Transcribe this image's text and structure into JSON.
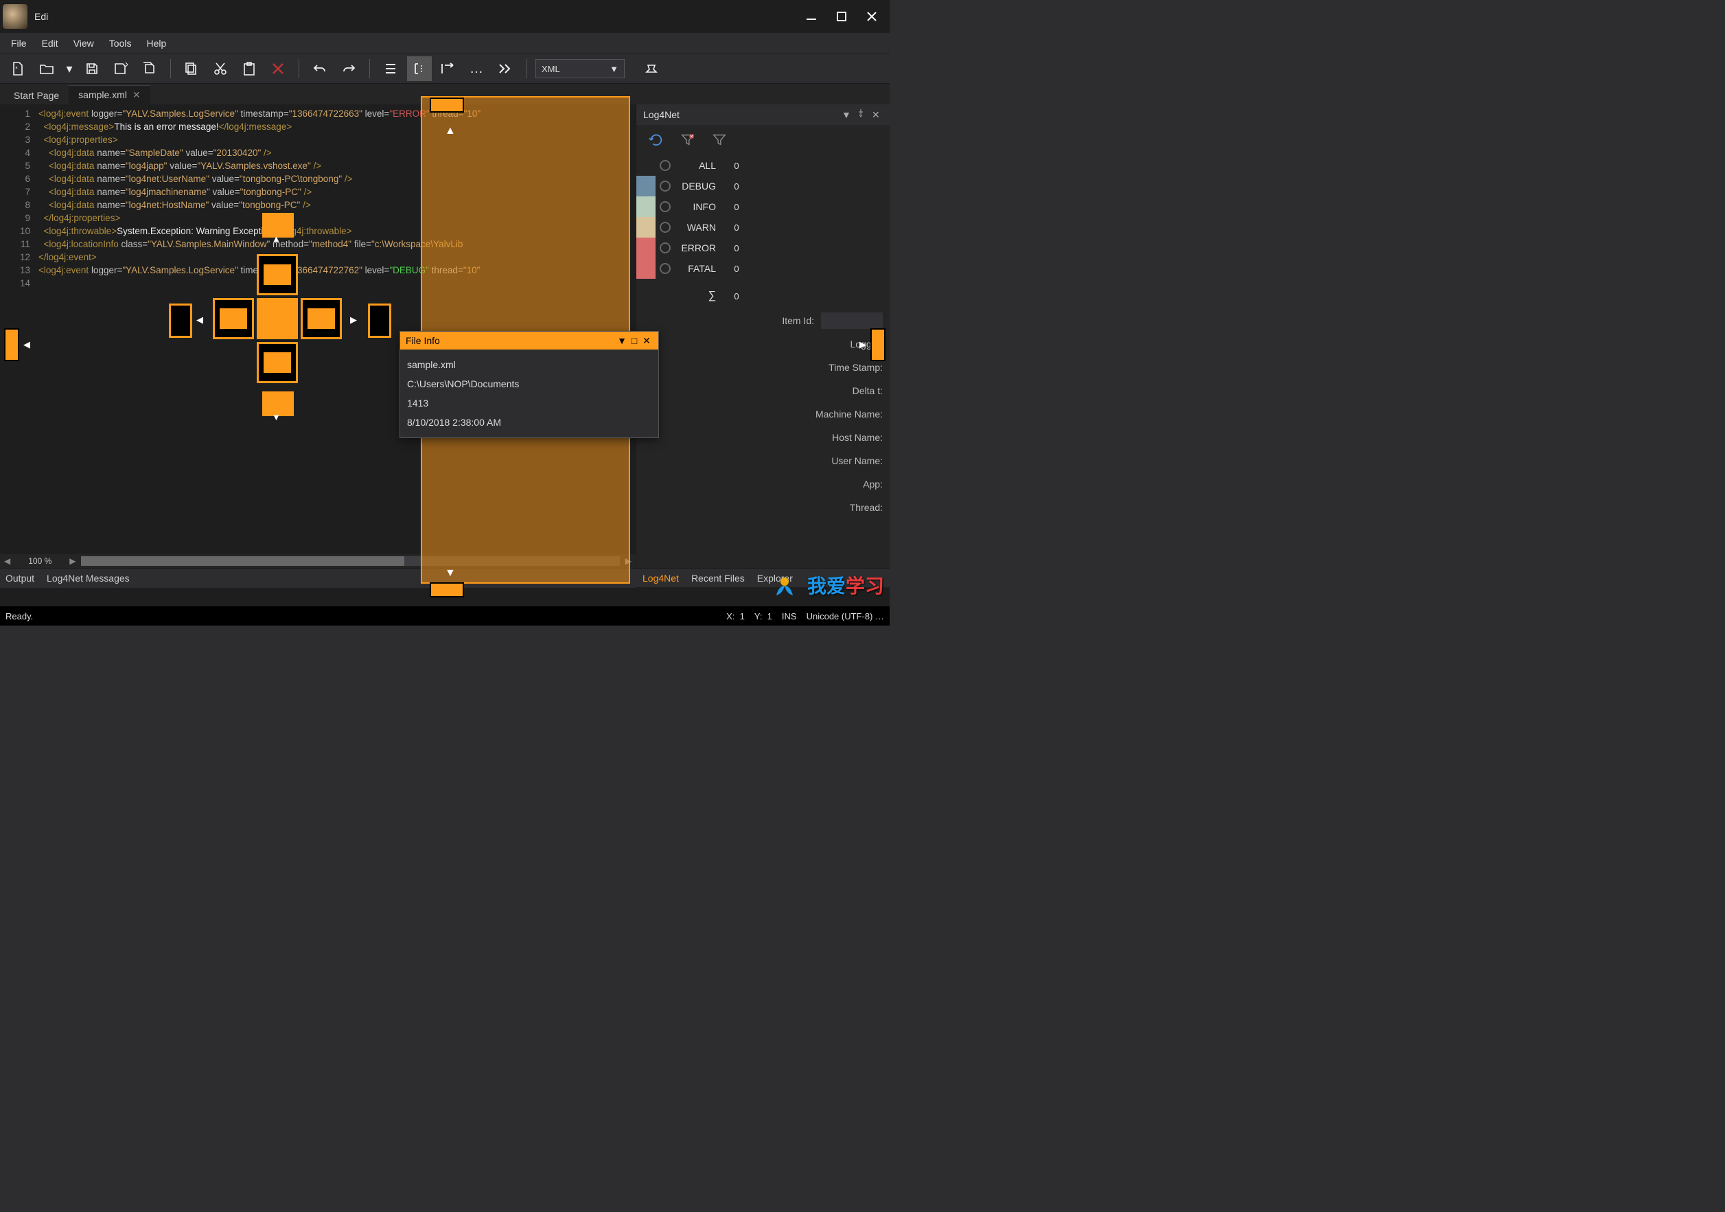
{
  "window": {
    "title": "Edi"
  },
  "menus": [
    "File",
    "Edit",
    "View",
    "Tools",
    "Help"
  ],
  "toolbar": {
    "combo_value": "XML"
  },
  "tabs": [
    {
      "label": "Start Page",
      "active": false,
      "closable": false
    },
    {
      "label": "sample.xml",
      "active": true,
      "closable": true
    }
  ],
  "code": {
    "lines": [
      1,
      2,
      3,
      4,
      5,
      6,
      7,
      8,
      9,
      10,
      11,
      12,
      13,
      14
    ],
    "l1_a": "<log4j:event ",
    "l1_b": "logger=",
    "l1_c": "\"YALV.Samples.LogService\"",
    "l1_d": " timestamp=",
    "l1_e": "\"1366474722663\"",
    "l1_f": " level=",
    "l1_g": "\"ERROR\"",
    "l1_h": " thread=",
    "l1_i": "\"10\"",
    "l2_a": "  <log4j:message>",
    "l2_b": "This is an error message!",
    "l2_c": "</log4j:message>",
    "l3": "  <log4j:properties>",
    "l4_a": "    <log4j:data ",
    "l4_b": "name=",
    "l4_c": "\"SampleDate\"",
    "l4_d": " value=",
    "l4_e": "\"20130420\"",
    "l4_f": " />",
    "l5_a": "    <log4j:data ",
    "l5_b": "name=",
    "l5_c": "\"log4japp\"",
    "l5_d": " value=",
    "l5_e": "\"YALV.Samples.vshost.exe\"",
    "l5_f": " />",
    "l6_a": "    <log4j:data ",
    "l6_b": "name=",
    "l6_c": "\"log4net:UserName\"",
    "l6_d": " value=",
    "l6_e": "\"tongbong-PC\\tongbong\"",
    "l6_f": " />",
    "l7_a": "    <log4j:data ",
    "l7_b": "name=",
    "l7_c": "\"log4jmachinename\"",
    "l7_d": " value=",
    "l7_e": "\"tongbong-PC\"",
    "l7_f": " />",
    "l8_a": "    <log4j:data ",
    "l8_b": "name=",
    "l8_c": "\"log4net:HostName\"",
    "l8_d": " value=",
    "l8_e": "\"tongbong-PC\"",
    "l8_f": " />",
    "l9": "  </log4j:properties>",
    "l10_a": "  <log4j:throwable>",
    "l10_b": "System.Exception: Warning Exception!",
    "l10_c": "</log4j:throwable>",
    "l11_a": "  <log4j:locationInfo ",
    "l11_b": "class=",
    "l11_c": "\"YALV.Samples.MainWindow\"",
    "l11_d": " method=",
    "l11_e": "\"method4\"",
    "l11_f": " file=",
    "l11_g": "\"c:\\Workspace\\YalvLib",
    "l12": "</log4j:event>",
    "l13_a": "<log4j:event ",
    "l13_b": "logger=",
    "l13_c": "\"YALV.Samples.LogService\"",
    "l13_d": " timestamp=",
    "l13_e": "\"1366474722762\"",
    "l13_f": " level=",
    "l13_g": "\"DEBUG\"",
    "l13_h": " thread=",
    "l13_i": "\"10\""
  },
  "editor_footer": {
    "zoom": "100 %"
  },
  "side_panel": {
    "title": "Log4Net",
    "levels": [
      {
        "label": "ALL",
        "count": "0",
        "color": "transparent"
      },
      {
        "label": "DEBUG",
        "count": "0",
        "color": "#6b8ca3"
      },
      {
        "label": "INFO",
        "count": "0",
        "color": "#b8ceba"
      },
      {
        "label": "WARN",
        "count": "0",
        "color": "#d9c39a"
      },
      {
        "label": "ERROR",
        "count": "0",
        "color": "#d96b6b"
      },
      {
        "label": "FATAL",
        "count": "0",
        "color": "#d96b6b"
      }
    ],
    "sum_label": "∑",
    "sum_count": "0",
    "props": [
      "Item Id:",
      "Logger:",
      "Time Stamp:",
      "Delta t:",
      "Machine Name:",
      "Host Name:",
      "User Name:",
      "App:",
      "Thread:"
    ],
    "tabs": [
      "Log4Net",
      "Recent Files",
      "Explorer"
    ]
  },
  "bottom_tabs": [
    "Output",
    "Log4Net Messages"
  ],
  "fileinfo": {
    "title": "File Info",
    "rows": [
      "sample.xml",
      "C:\\Users\\NOP\\Documents",
      "1413",
      "8/10/2018 2:38:00 AM"
    ]
  },
  "status": {
    "ready": "Ready.",
    "x_label": "X:",
    "x": "1",
    "y_label": "Y:",
    "y": "1",
    "ins": "INS",
    "enc": "Unicode (UTF-8) …"
  },
  "watermark": {
    "a": "我爱",
    "b": "学习"
  }
}
